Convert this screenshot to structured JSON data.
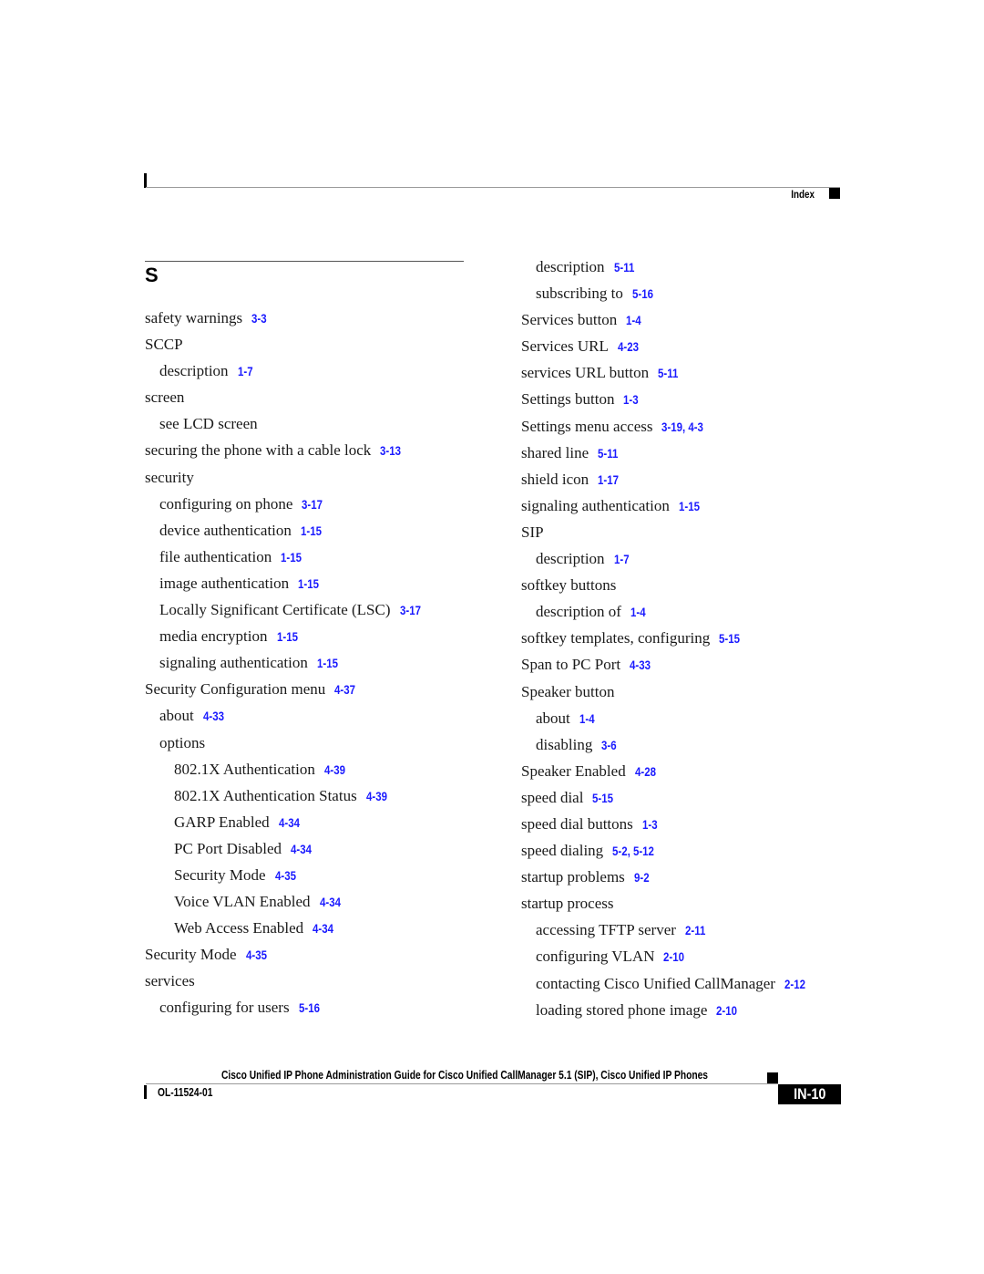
{
  "header": {
    "section_label": "Index"
  },
  "section_letter": "S",
  "left_column": [
    {
      "level": 1,
      "term": "safety warnings",
      "refs": "3-3"
    },
    {
      "level": 1,
      "term": "SCCP",
      "refs": ""
    },
    {
      "level": 2,
      "term": "description",
      "refs": "1-7"
    },
    {
      "level": 1,
      "term": "screen",
      "refs": ""
    },
    {
      "level": 2,
      "term": "see LCD screen",
      "refs": ""
    },
    {
      "level": 1,
      "term": "securing the phone with a cable lock",
      "refs": "3-13"
    },
    {
      "level": 1,
      "term": "security",
      "refs": ""
    },
    {
      "level": 2,
      "term": "configuring on phone",
      "refs": "3-17"
    },
    {
      "level": 2,
      "term": "device authentication",
      "refs": "1-15"
    },
    {
      "level": 2,
      "term": "file authentication",
      "refs": "1-15"
    },
    {
      "level": 2,
      "term": "image authentication",
      "refs": "1-15"
    },
    {
      "level": 2,
      "term": "Locally Significant Certificate (LSC)",
      "refs": "3-17"
    },
    {
      "level": 2,
      "term": "media encryption",
      "refs": "1-15"
    },
    {
      "level": 2,
      "term": "signaling authentication",
      "refs": "1-15"
    },
    {
      "level": 1,
      "term": "Security Configuration menu",
      "refs": "4-37"
    },
    {
      "level": 2,
      "term": "about",
      "refs": "4-33"
    },
    {
      "level": 2,
      "term": "options",
      "refs": ""
    },
    {
      "level": 3,
      "term": "802.1X Authentication",
      "refs": "4-39"
    },
    {
      "level": 3,
      "term": "802.1X Authentication Status",
      "refs": "4-39"
    },
    {
      "level": 3,
      "term": "GARP Enabled",
      "refs": "4-34"
    },
    {
      "level": 3,
      "term": "PC Port Disabled",
      "refs": "4-34"
    },
    {
      "level": 3,
      "term": "Security Mode",
      "refs": "4-35"
    },
    {
      "level": 3,
      "term": "Voice VLAN Enabled",
      "refs": "4-34"
    },
    {
      "level": 3,
      "term": "Web Access Enabled",
      "refs": "4-34"
    },
    {
      "level": 1,
      "term": "Security Mode",
      "refs": "4-35"
    },
    {
      "level": 1,
      "term": "services",
      "refs": ""
    },
    {
      "level": 2,
      "term": "configuring for users",
      "refs": "5-16"
    }
  ],
  "right_column": [
    {
      "level": 2,
      "term": "description",
      "refs": "5-11"
    },
    {
      "level": 2,
      "term": "subscribing to",
      "refs": "5-16"
    },
    {
      "level": 1,
      "term": "Services button",
      "refs": "1-4"
    },
    {
      "level": 1,
      "term": "Services URL",
      "refs": "4-23"
    },
    {
      "level": 1,
      "term": "services URL button",
      "refs": "5-11"
    },
    {
      "level": 1,
      "term": "Settings button",
      "refs": "1-3"
    },
    {
      "level": 1,
      "term": "Settings menu access",
      "refs": "3-19, 4-3"
    },
    {
      "level": 1,
      "term": "shared line",
      "refs": "5-11"
    },
    {
      "level": 1,
      "term": "shield icon",
      "refs": "1-17"
    },
    {
      "level": 1,
      "term": "signaling authentication",
      "refs": "1-15"
    },
    {
      "level": 1,
      "term": "SIP",
      "refs": ""
    },
    {
      "level": 2,
      "term": "description",
      "refs": "1-7"
    },
    {
      "level": 1,
      "term": "softkey buttons",
      "refs": ""
    },
    {
      "level": 2,
      "term": "description of",
      "refs": "1-4"
    },
    {
      "level": 1,
      "term": "softkey templates, configuring",
      "refs": "5-15"
    },
    {
      "level": 1,
      "term": "Span to PC Port",
      "refs": "4-33"
    },
    {
      "level": 1,
      "term": "Speaker button",
      "refs": ""
    },
    {
      "level": 2,
      "term": "about",
      "refs": "1-4"
    },
    {
      "level": 2,
      "term": "disabling",
      "refs": "3-6"
    },
    {
      "level": 1,
      "term": "Speaker Enabled",
      "refs": "4-28"
    },
    {
      "level": 1,
      "term": "speed dial",
      "refs": "5-15"
    },
    {
      "level": 1,
      "term": "speed dial buttons",
      "refs": "1-3"
    },
    {
      "level": 1,
      "term": "speed dialing",
      "refs": "5-2, 5-12"
    },
    {
      "level": 1,
      "term": "startup problems",
      "refs": "9-2"
    },
    {
      "level": 1,
      "term": "startup process",
      "refs": ""
    },
    {
      "level": 2,
      "term": "accessing TFTP server",
      "refs": "2-11"
    },
    {
      "level": 2,
      "term": "configuring VLAN",
      "refs": "2-10"
    },
    {
      "level": 2,
      "term": "contacting Cisco Unified CallManager",
      "refs": "2-12"
    },
    {
      "level": 2,
      "term": "loading stored phone image",
      "refs": "2-10"
    }
  ],
  "footer": {
    "title": "Cisco Unified IP Phone Administration Guide for Cisco Unified CallManager 5.1 (SIP), Cisco Unified IP Phones",
    "doc_number": "OL-11524-01",
    "page_number": "IN-10"
  },
  "colors": {
    "link": "#1a1aff",
    "text": "#1a1a1a"
  }
}
